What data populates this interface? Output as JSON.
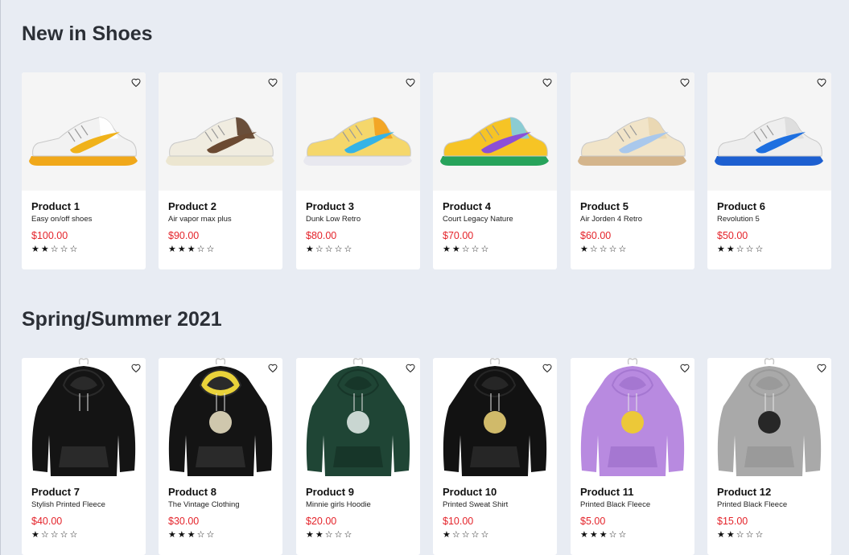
{
  "sections": [
    {
      "title": "New in Shoes",
      "products": [
        {
          "name": "Product 1",
          "desc": "Easy on/off shoes",
          "price": "$100.00",
          "rating": 2,
          "type": "shoe",
          "colors": {
            "base": "#f2f2f2",
            "swoosh": "#f0b21a",
            "sole": "#f0a81a",
            "accent": "#ffffff"
          }
        },
        {
          "name": "Product 2",
          "desc": "Air vapor max plus",
          "price": "$90.00",
          "rating": 3,
          "type": "shoe",
          "colors": {
            "base": "#f0ece0",
            "swoosh": "#6b4a32",
            "sole": "#ece6d0",
            "accent": "#5a3d28"
          }
        },
        {
          "name": "Product 3",
          "desc": "Dunk Low Retro",
          "price": "$80.00",
          "rating": 1,
          "type": "shoe",
          "colors": {
            "base": "#f5d76b",
            "swoosh": "#35b3e6",
            "sole": "#e8e8ef",
            "accent": "#f3a11f"
          }
        },
        {
          "name": "Product 4",
          "desc": "Court Legacy Nature",
          "price": "$70.00",
          "rating": 2,
          "type": "shoe",
          "colors": {
            "base": "#f6c425",
            "swoosh": "#8c4fd6",
            "sole": "#27a35b",
            "accent": "#7fcde6"
          }
        },
        {
          "name": "Product 5",
          "desc": "Air Jorden 4 Retro",
          "price": "$60.00",
          "rating": 1,
          "type": "shoe",
          "colors": {
            "base": "#f1e4c8",
            "swoosh": "#a9c8ec",
            "sole": "#d4b58c",
            "accent": "#e9d6b0"
          }
        },
        {
          "name": "Product 6",
          "desc": "Revolution 5",
          "price": "$50.00",
          "rating": 2,
          "type": "shoe",
          "colors": {
            "base": "#eeeeee",
            "swoosh": "#1d6fe0",
            "sole": "#1d5fd0",
            "accent": "#dcdcdc"
          }
        }
      ]
    },
    {
      "title": "Spring/Summer 2021",
      "products": [
        {
          "name": "Product 7",
          "desc": "Stylish Printed Fleece",
          "price": "$40.00",
          "rating": 1,
          "type": "hoodie",
          "colors": {
            "base": "#141414",
            "swoosh": "#141414",
            "sole": "#2a2a2a",
            "accent": "#141414"
          }
        },
        {
          "name": "Product 8",
          "desc": "The Vintage Clothing",
          "price": "$30.00",
          "rating": 3,
          "type": "hoodie",
          "colors": {
            "base": "#141414",
            "swoosh": "#e9d23a",
            "sole": "#2a2a2a",
            "accent": "#f0e6c8"
          }
        },
        {
          "name": "Product 9",
          "desc": "Minnie girls Hoodie",
          "price": "$20.00",
          "rating": 2,
          "type": "hoodie",
          "colors": {
            "base": "#1f4535",
            "swoosh": "#1f4535",
            "sole": "#173629",
            "accent": "#e8f0ec"
          }
        },
        {
          "name": "Product 10",
          "desc": "Printed Sweat Shirt",
          "price": "$10.00",
          "rating": 1,
          "type": "hoodie",
          "colors": {
            "base": "#121212",
            "swoosh": "#121212",
            "sole": "#262626",
            "accent": "#f2d87a"
          }
        },
        {
          "name": "Product 11",
          "desc": "Printed Black Fleece",
          "price": "$5.00",
          "rating": 3,
          "type": "hoodie",
          "colors": {
            "base": "#b88ae0",
            "swoosh": "#b88ae0",
            "sole": "#a577d1",
            "accent": "#f5d21a"
          }
        },
        {
          "name": "Product 12",
          "desc": "Printed Black Fleece",
          "price": "$15.00",
          "rating": 2,
          "type": "hoodie",
          "colors": {
            "base": "#a9a9a9",
            "swoosh": "#a9a9a9",
            "sole": "#9a9a9a",
            "accent": "#111111"
          }
        }
      ]
    }
  ],
  "max_rating": 5,
  "icons": {
    "favorite": "heart-outline-icon",
    "star_filled": "★",
    "star_empty": "☆"
  },
  "theme": {
    "price_color": "#e4232a",
    "page_bg": "#e8ecf3",
    "card_bg": "#ffffff"
  }
}
